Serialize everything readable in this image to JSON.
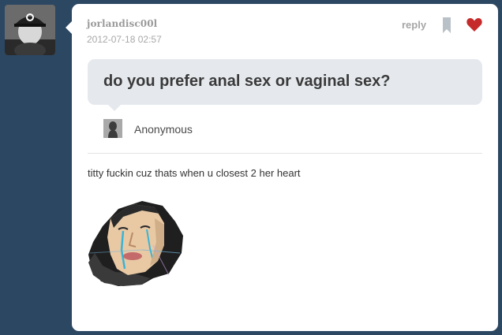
{
  "post": {
    "username": "jorlandisc00l",
    "timestamp": "2012-07-18 02:57",
    "actions": {
      "reply_label": "reply",
      "reblog_icon": "reblog-bookmark-icon",
      "like_icon": "heart-icon"
    },
    "colors": {
      "page_background": "#2c4762",
      "card_background": "#ffffff",
      "question_background": "#e5e9ed",
      "heart": "#c52b2b"
    }
  },
  "question": {
    "text": "do you prefer anal sex or vaginal sex?",
    "asker_name": "Anonymous"
  },
  "answer": {
    "text": "titty fuckin cuz thats when u closest 2 her heart"
  }
}
